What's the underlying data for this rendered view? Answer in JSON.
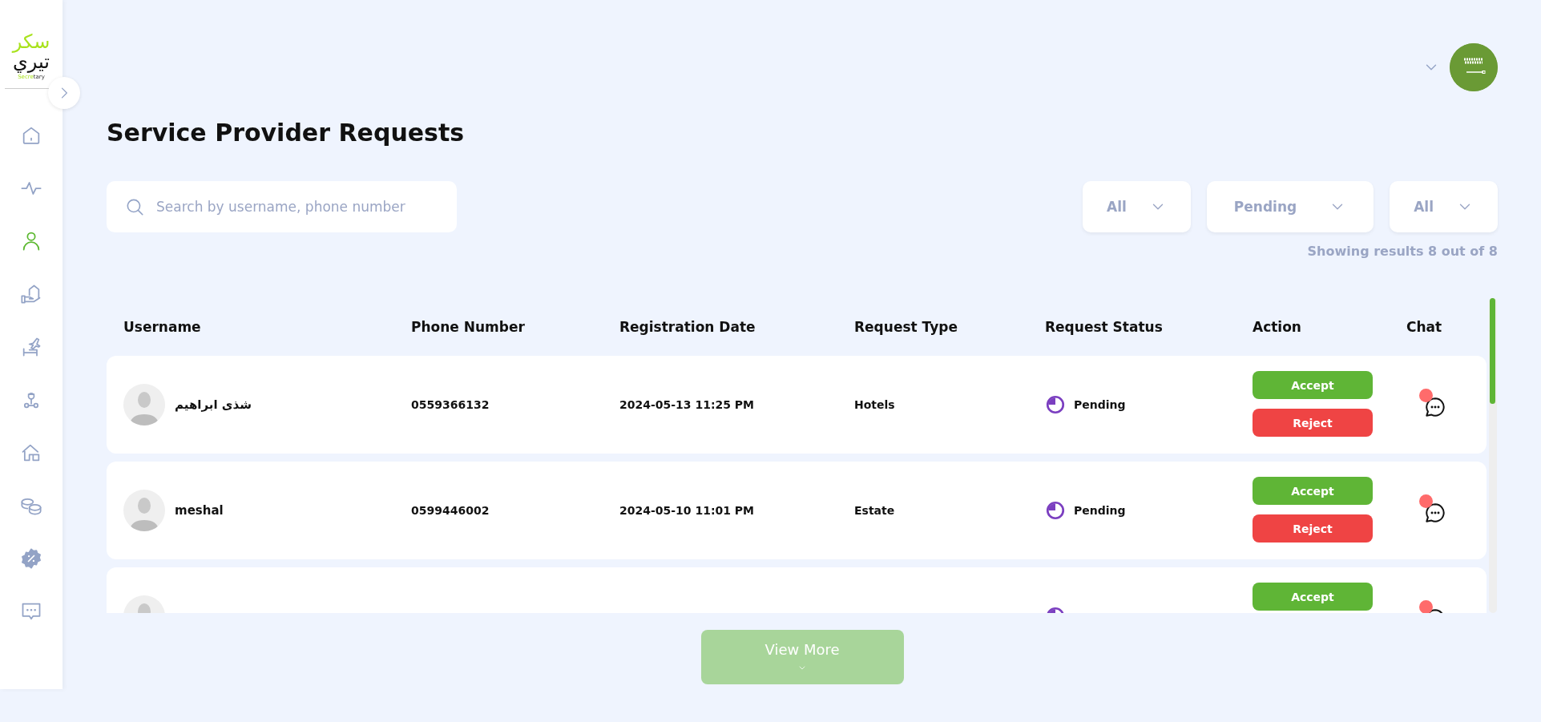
{
  "logo": {
    "line_1": "سكر",
    "line_2": "تيري",
    "subtitle_part_1": "Secre",
    "subtitle_part_2": "tary"
  },
  "sidebar": {
    "items": [
      {
        "selected": false
      },
      {
        "selected": false
      },
      {
        "selected": true
      },
      {
        "selected": false
      },
      {
        "selected": false
      },
      {
        "selected": false
      },
      {
        "selected": false
      },
      {
        "selected": false
      },
      {
        "selected": false
      },
      {
        "selected": false
      }
    ]
  },
  "page_title": "Service Provider Requests",
  "search": {
    "placeholder": "Search by username, phone number"
  },
  "filters": [
    {
      "value": "All"
    },
    {
      "value": "Pending"
    },
    {
      "value": "All"
    }
  ],
  "results_summary": "Showing results 8 out of 8",
  "table": {
    "columns": [
      "Username",
      "Phone Number",
      "Registration Date",
      "Request Type",
      "Request Status",
      "Action",
      "Chat"
    ],
    "rows": [
      {
        "username": "شذى ابراهيم",
        "phone": "0559366132",
        "registration_date": "2024-05-13 11:25 PM",
        "request_type": "Hotels",
        "status": "Pending",
        "actions": [
          "Accept",
          "Reject"
        ],
        "chat_unread": true
      },
      {
        "username": "meshal",
        "phone": "0599446002",
        "registration_date": "2024-05-10 11:01 PM",
        "request_type": "Estate",
        "status": "Pending",
        "actions": [
          "Accept",
          "Reject"
        ],
        "chat_unread": true
      },
      {
        "actions": [
          "Accept"
        ],
        "chat_unread": true
      }
    ]
  },
  "view_more": "View More"
}
